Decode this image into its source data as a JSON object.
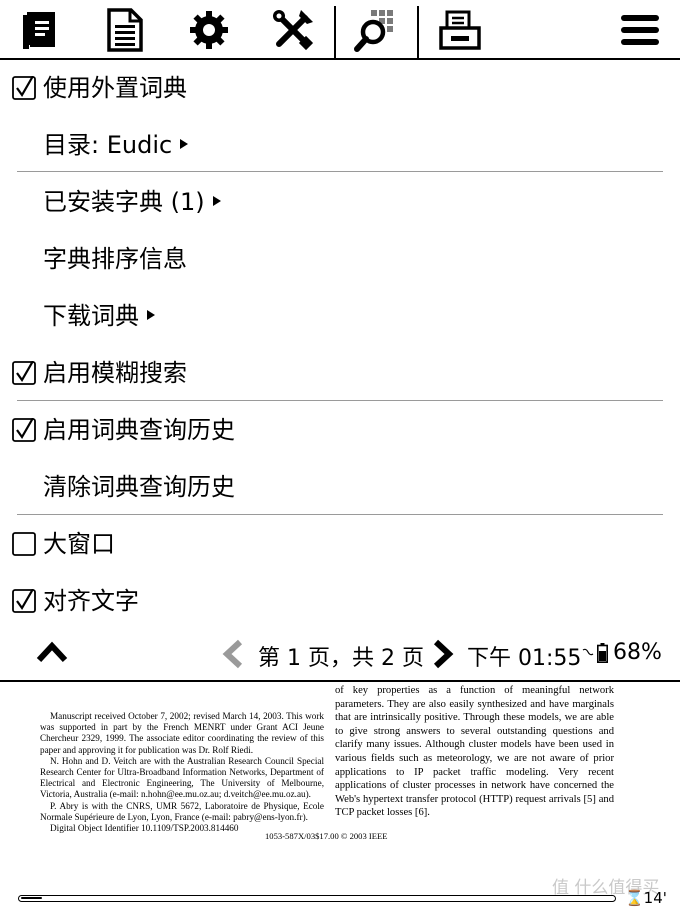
{
  "toolbar": {
    "items": [
      {
        "icon": "bookmark-book-icon"
      },
      {
        "icon": "document-icon"
      },
      {
        "icon": "gear-icon"
      },
      {
        "icon": "tools-icon"
      },
      {
        "icon": "search-dictionary-icon",
        "active": true
      },
      {
        "icon": "device-storage-icon"
      },
      {
        "icon": "hamburger-menu-icon"
      }
    ]
  },
  "menu": {
    "items": [
      {
        "label": "使用外置词典",
        "checked": true
      },
      {
        "label": "目录: Eudic",
        "submenu": true
      },
      {
        "label": "已安装字典 (1)",
        "submenu": true
      },
      {
        "label": "字典排序信息"
      },
      {
        "label": "下载词典",
        "submenu": true
      },
      {
        "label": "启用模糊搜索",
        "checked": true
      },
      {
        "label": "启用词典查询历史",
        "checked": true
      },
      {
        "label": "清除词典查询历史"
      },
      {
        "label": "大窗口",
        "checked": false
      },
      {
        "label": "对齐文字",
        "checked": true
      }
    ]
  },
  "status": {
    "page_text": "第 1 页，共 2 页",
    "time": "下午 01:55",
    "battery": "68%"
  },
  "document": {
    "footnote": [
      "Manuscript received October 7, 2002; revised March 14, 2003. This work was supported in part by the French MENRT under Grant ACI Jeune Chercheur 2329, 1999. The associate editor coordinating the review of this paper and approving it for publication was Dr. Rolf Riedi.",
      "N. Hohn and D. Veitch are with the Australian Research Council Special Research Center for Ultra-Broadband Information Networks, Department of Electrical and Electronic Engineering, The University of Melbourne, Victoria, Australia (e-mail: n.hohn@ee.mu.oz.au; d.veitch@ee.mu.oz.au).",
      "P. Abry is with the CNRS, UMR 5672, Laboratoire de Physique, Ecole Normale Supérieure de Lyon, Lyon, France (e-mail: pabry@ens-lyon.fr).",
      "Digital Object Identifier 10.1109/TSP.2003.814460"
    ],
    "body": "of key properties as a function of meaningful network parameters. They are also easily synthesized and have marginals that are intrinsically positive. Through these models, we are able to give strong answers to several outstanding questions and clarify many issues. Although cluster models have been used in various fields such as meteorology, we are not aware of prior applications to IP packet traffic modeling. Very recent applications of cluster processes in network have concerned the Web's hypertext transfer protocol (HTTP) request arrivals [5] and TCP packet losses [6].",
    "copyright": "1053-587X/03$17.00 © 2003 IEEE",
    "reading_progress": 0.035,
    "page_counter": "⌛14'"
  },
  "watermark": "值 什么值得买"
}
